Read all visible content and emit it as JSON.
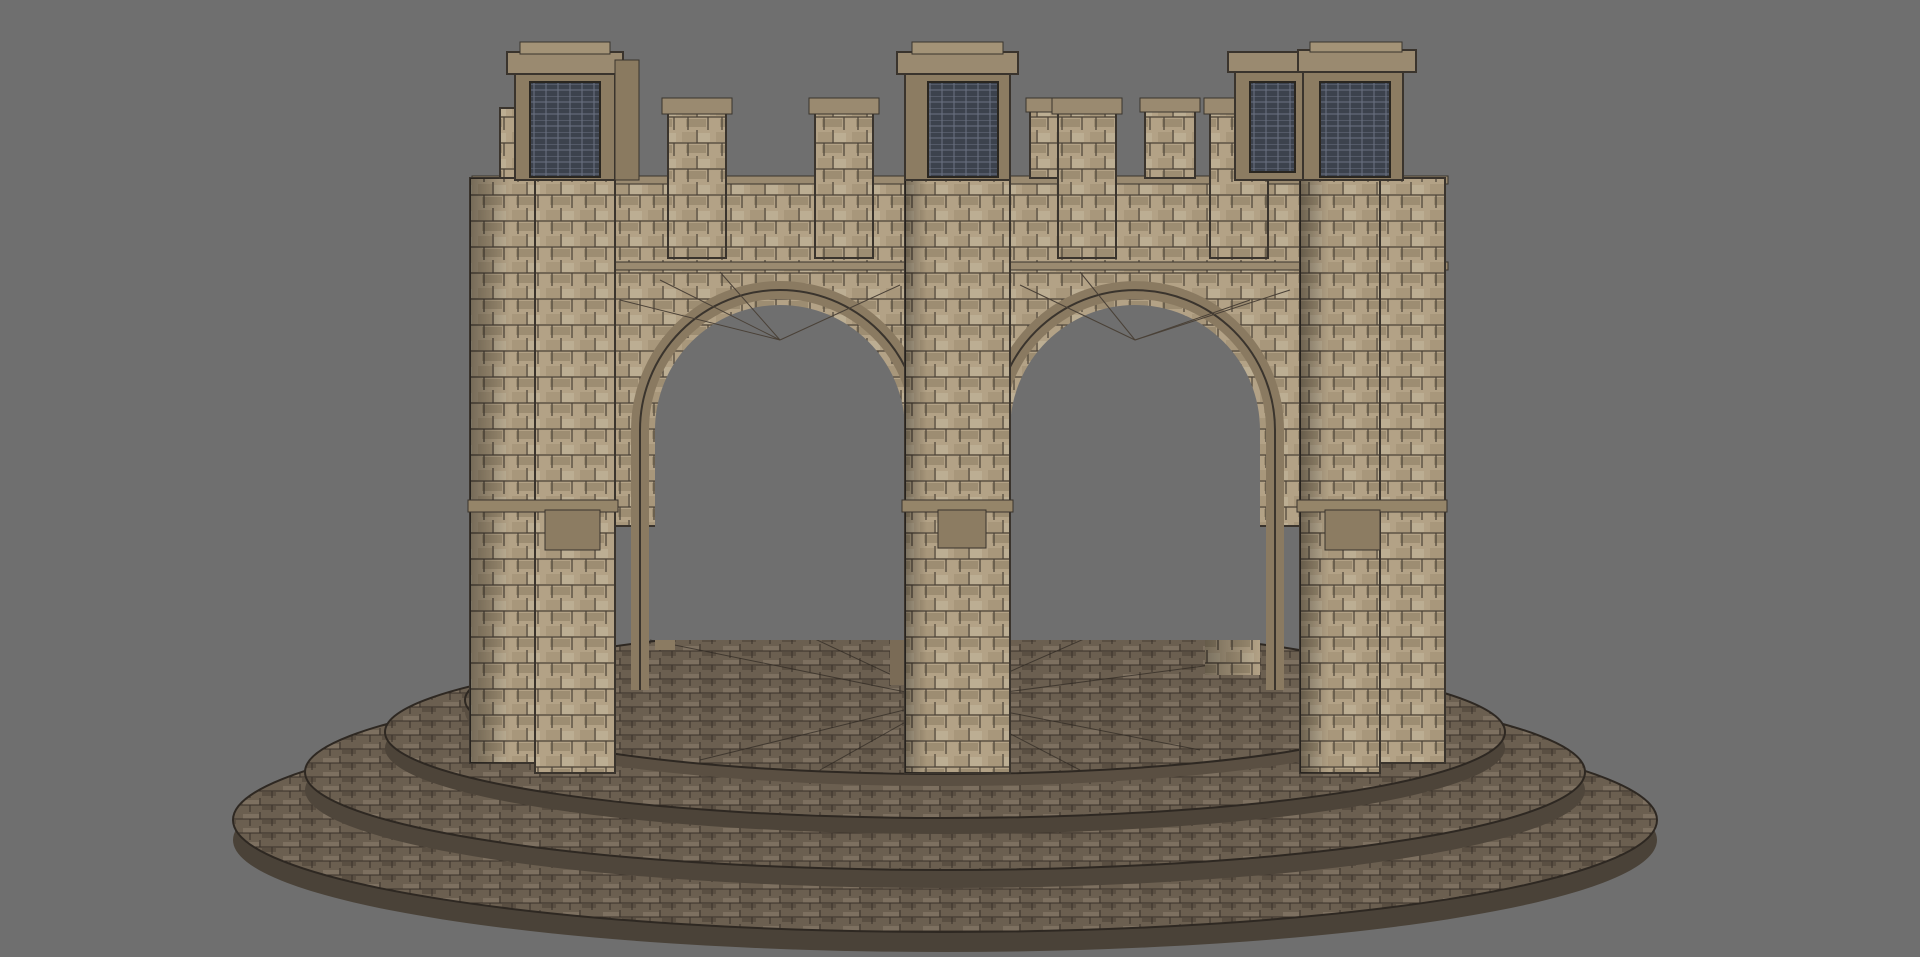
{
  "viewport": {
    "background_color": "#6f6f6f"
  },
  "model": {
    "subject": "stone-arch-pavilion",
    "stone_color_light": "#b7a68a",
    "stone_color_mid": "#8f7f66",
    "stone_color_dark": "#4e443a",
    "floor_color": "#6d6151",
    "floor_dark": "#3b342c",
    "window_color": "#3e4450",
    "window_grid_color": "#6a7180",
    "mortar_color": "#3a342d"
  }
}
